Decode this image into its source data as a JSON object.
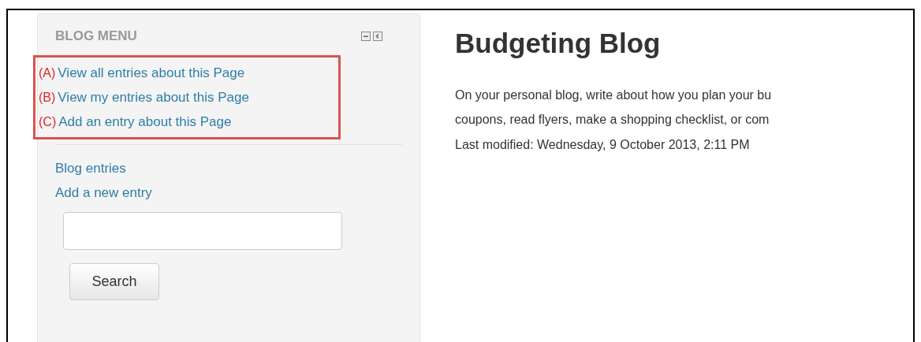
{
  "block": {
    "title": "BLOG MENU",
    "page_links": [
      {
        "marker": "(A)",
        "label": "View all entries about this Page"
      },
      {
        "marker": "(B)",
        "label": "View my entries about this Page"
      },
      {
        "marker": "(C)",
        "label": "Add an entry about this Page"
      }
    ],
    "links": [
      "Blog entries",
      "Add a new entry"
    ],
    "search_button": "Search"
  },
  "main": {
    "title": "Budgeting Blog",
    "paragraph_lines": [
      "On your personal blog, write about how you plan your bu",
      "coupons, read flyers, make a shopping checklist, or com"
    ],
    "last_modified": "Last modified: Wednesday, 9 October 2013, 2:11 PM"
  }
}
